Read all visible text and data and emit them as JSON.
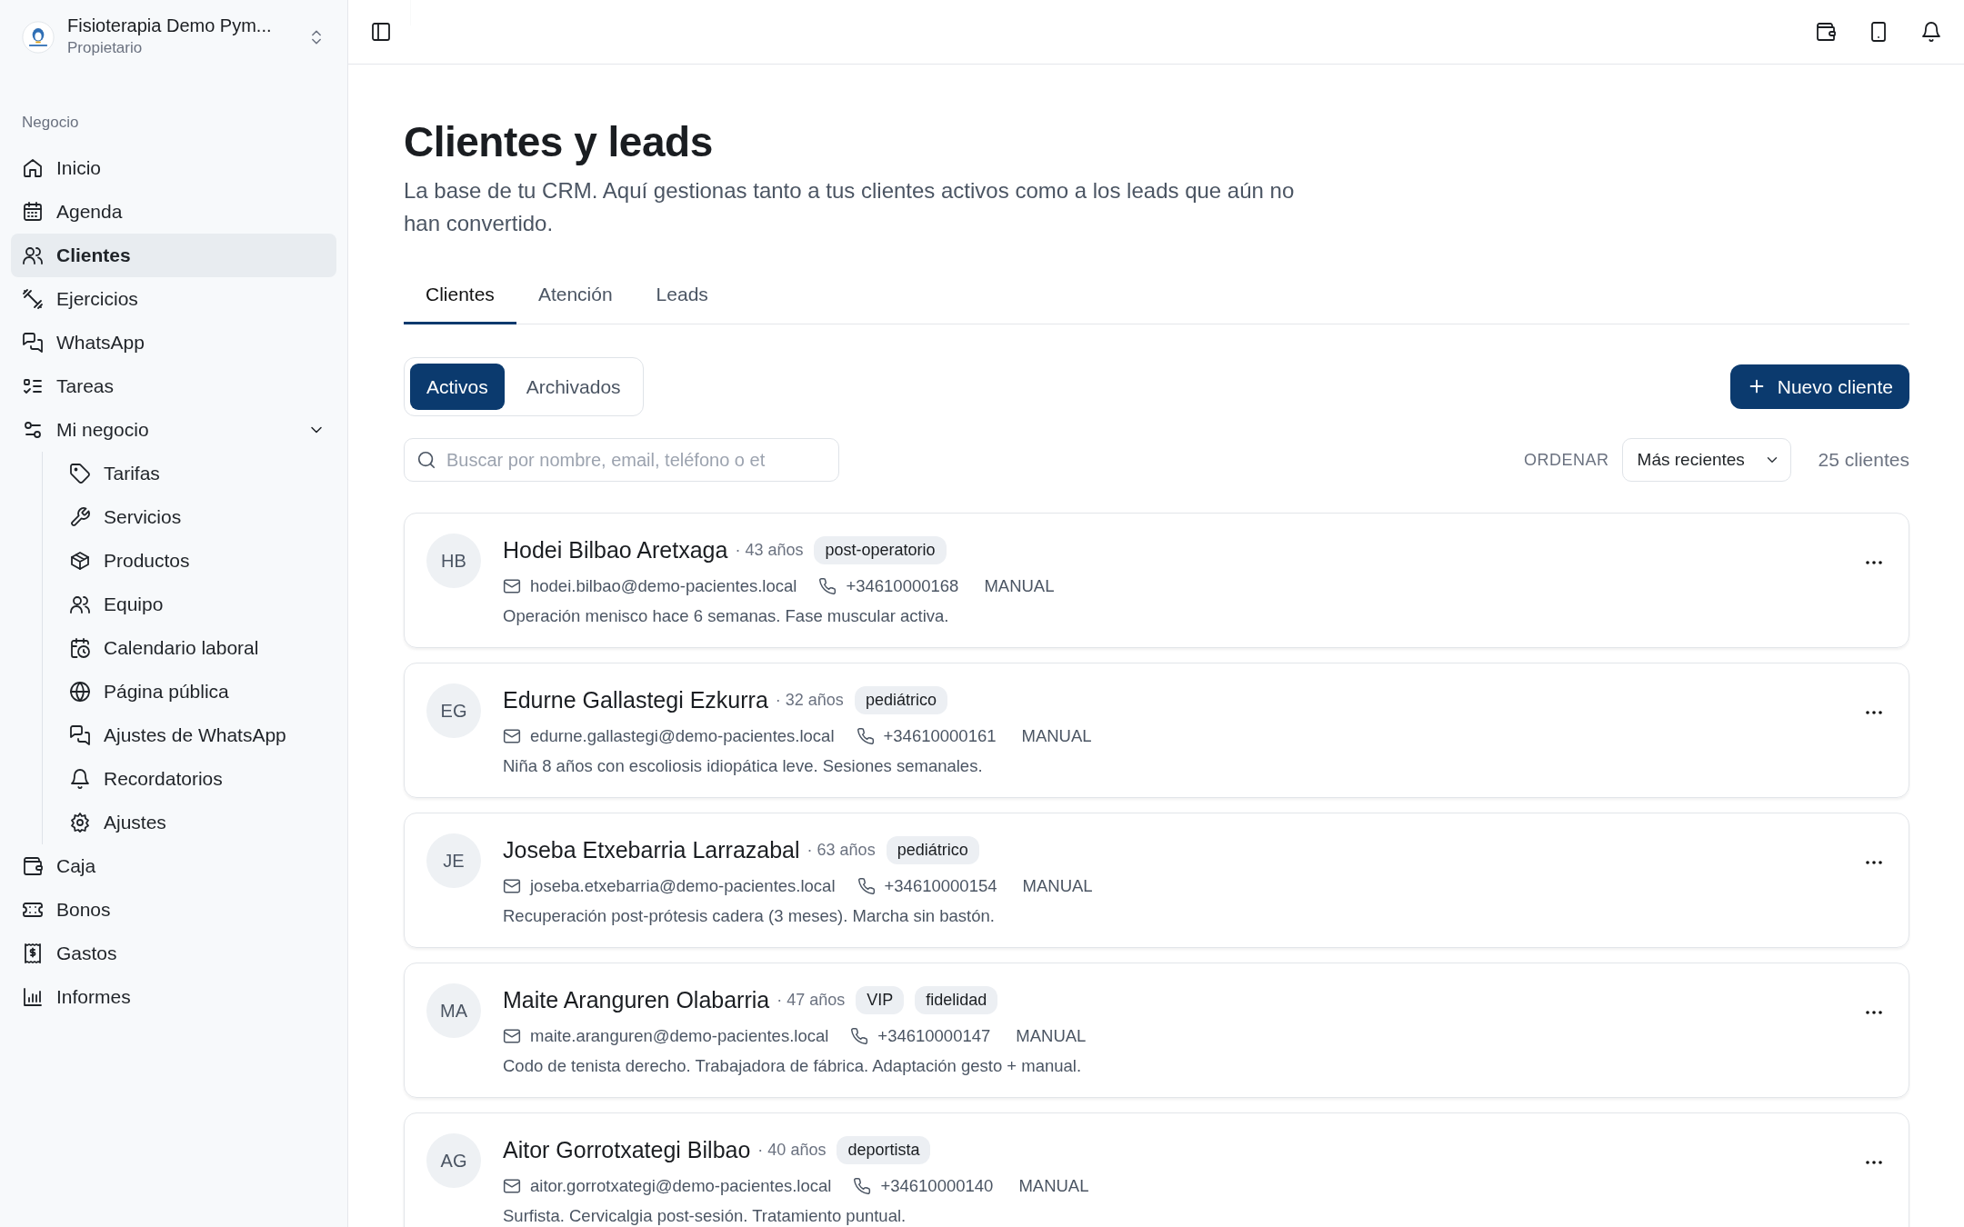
{
  "workspace": {
    "name": "Fisioterapia Demo Pym...",
    "role": "Propietario"
  },
  "sidebar": {
    "section": "Negocio",
    "items": [
      {
        "label": "Inicio",
        "selected": false
      },
      {
        "label": "Agenda",
        "selected": false
      },
      {
        "label": "Clientes",
        "selected": true
      },
      {
        "label": "Ejercicios",
        "selected": false
      },
      {
        "label": "WhatsApp",
        "selected": false
      },
      {
        "label": "Tareas",
        "selected": false
      },
      {
        "label": "Mi negocio",
        "selected": false,
        "expanded": true,
        "children": [
          {
            "label": "Tarifas",
            "selected": false
          },
          {
            "label": "Servicios",
            "selected": false
          },
          {
            "label": "Productos",
            "selected": false
          },
          {
            "label": "Equipo",
            "selected": false
          },
          {
            "label": "Calendario laboral",
            "selected": false
          },
          {
            "label": "Página pública",
            "selected": false
          },
          {
            "label": "Ajustes de WhatsApp",
            "selected": false
          },
          {
            "label": "Recordatorios",
            "selected": false
          },
          {
            "label": "Ajustes",
            "selected": false
          }
        ]
      },
      {
        "label": "Caja",
        "selected": false
      },
      {
        "label": "Bonos",
        "selected": false
      },
      {
        "label": "Gastos",
        "selected": false
      },
      {
        "label": "Informes",
        "selected": false
      }
    ]
  },
  "page": {
    "title": "Clientes y leads",
    "description": "La base de tu CRM. Aquí gestionas tanto a tus clientes activos como a los leads que aún no han convertido."
  },
  "tabs": [
    {
      "label": "Clientes",
      "selected": true
    },
    {
      "label": "Atención",
      "selected": false
    },
    {
      "label": "Leads",
      "selected": false
    }
  ],
  "filter_tabs": [
    {
      "label": "Activos",
      "selected": true
    },
    {
      "label": "Archivados",
      "selected": false
    }
  ],
  "new_button": "Nuevo cliente",
  "search": {
    "placeholder": "Buscar por nombre, email, teléfono o et"
  },
  "sort": {
    "label": "ORDENAR",
    "value": "Más recientes"
  },
  "count": "25 clientes",
  "clients": [
    {
      "initials": "HB",
      "name": "Hodei Bilbao Aretxaga",
      "age": "· 43 años",
      "tags": [
        "post-operatorio"
      ],
      "email": "hodei.bilbao@demo-pacientes.local",
      "phone": "+34610000168",
      "source": "MANUAL",
      "note": "Operación menisco hace 6 semanas. Fase muscular activa."
    },
    {
      "initials": "EG",
      "name": "Edurne Gallastegi Ezkurra",
      "age": "· 32 años",
      "tags": [
        "pediátrico"
      ],
      "email": "edurne.gallastegi@demo-pacientes.local",
      "phone": "+34610000161",
      "source": "MANUAL",
      "note": "Niña 8 años con escoliosis idiopática leve. Sesiones semanales."
    },
    {
      "initials": "JE",
      "name": "Joseba Etxebarria Larrazabal",
      "age": "· 63 años",
      "tags": [
        "pediátrico"
      ],
      "email": "joseba.etxebarria@demo-pacientes.local",
      "phone": "+34610000154",
      "source": "MANUAL",
      "note": "Recuperación post-prótesis cadera (3 meses). Marcha sin bastón."
    },
    {
      "initials": "MA",
      "name": "Maite Aranguren Olabarria",
      "age": "· 47 años",
      "tags": [
        "VIP",
        "fidelidad"
      ],
      "email": "maite.aranguren@demo-pacientes.local",
      "phone": "+34610000147",
      "source": "MANUAL",
      "note": "Codo de tenista derecho. Trabajadora de fábrica. Adaptación gesto + manual."
    },
    {
      "initials": "AG",
      "name": "Aitor Gorrotxategi Bilbao",
      "age": "· 40 años",
      "tags": [
        "deportista"
      ],
      "email": "aitor.gorrotxategi@demo-pacientes.local",
      "phone": "+34610000140",
      "source": "MANUAL",
      "note": "Surfista. Cervicalgia post-sesión. Tratamiento puntual."
    }
  ]
}
